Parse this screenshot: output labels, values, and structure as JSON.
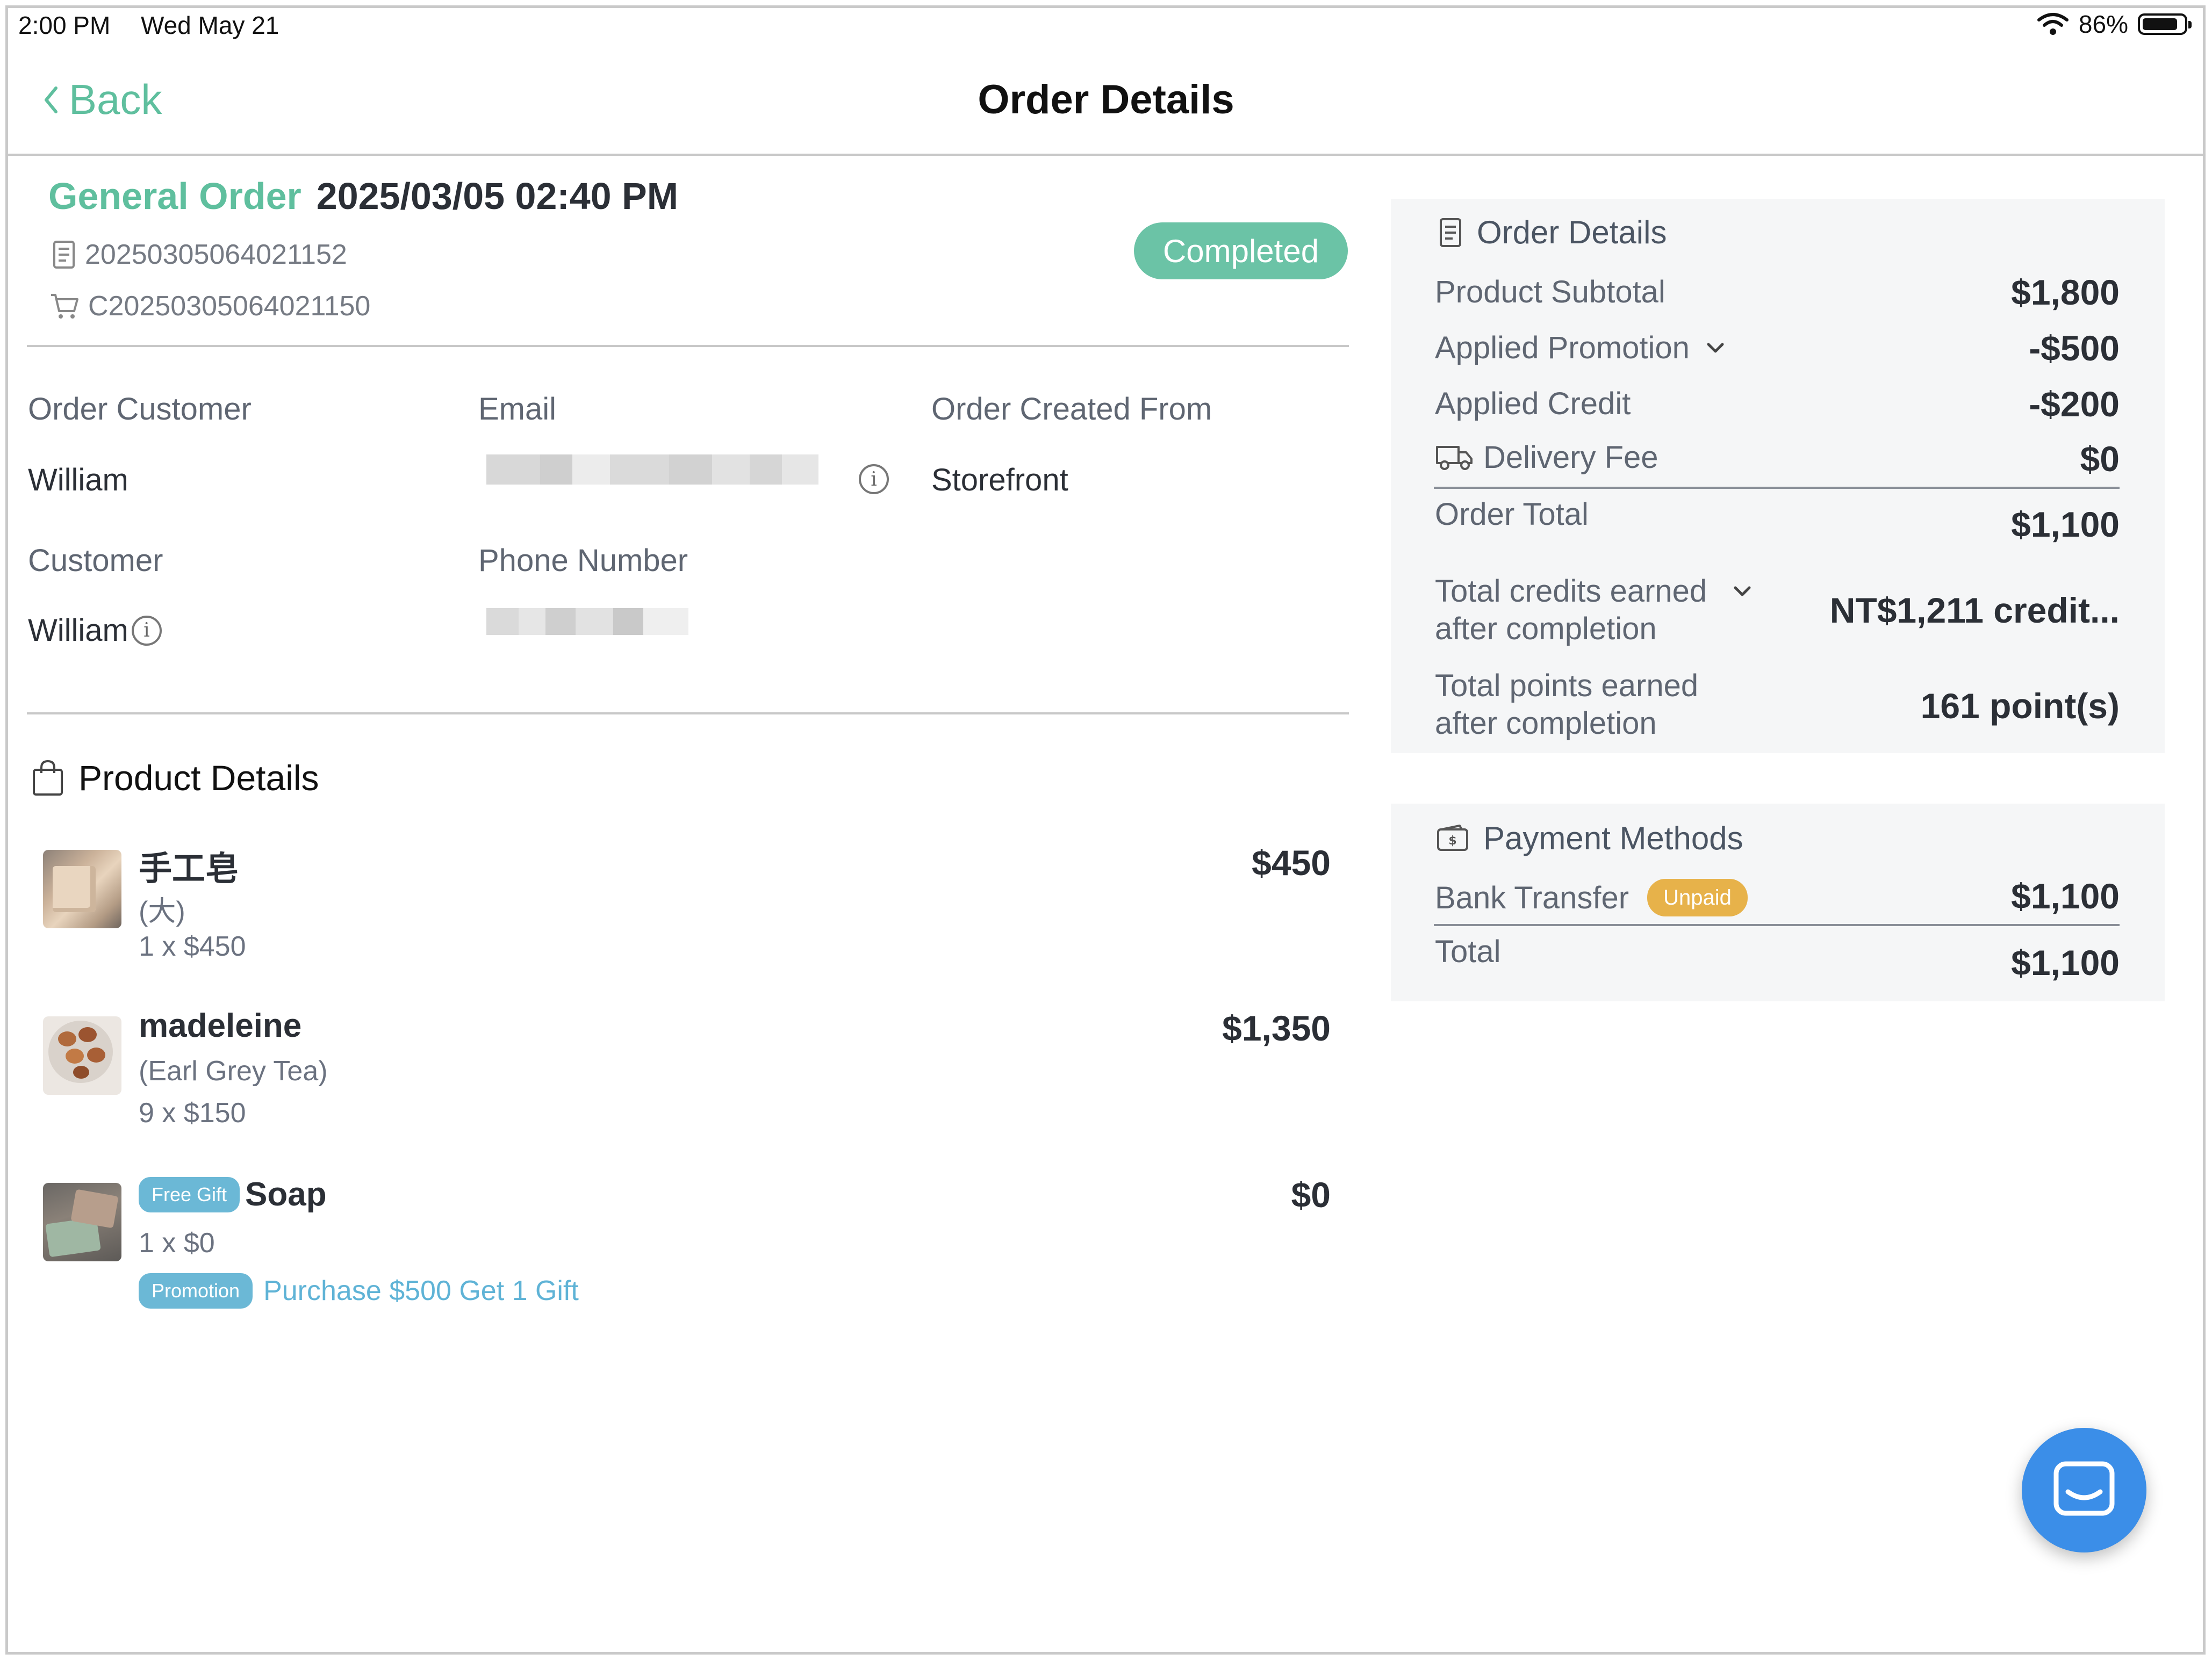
{
  "status_bar": {
    "time": "2:00 PM",
    "date": "Wed May 21",
    "battery": "86%",
    "battery_level": 0.86
  },
  "nav": {
    "back_label": "Back",
    "title": "Order Details"
  },
  "order": {
    "type": "General Order",
    "datetime": "2025/03/05 02:40 PM",
    "order_number": "20250305064021152",
    "cart_number": "C20250305064021150",
    "status": "Completed"
  },
  "customer_info": {
    "order_customer_label": "Order Customer",
    "order_customer_value": "William",
    "email_label": "Email",
    "created_from_label": "Order Created From",
    "created_from_value": "Storefront",
    "customer_label": "Customer",
    "customer_value": "William",
    "phone_label": "Phone Number"
  },
  "products": {
    "title": "Product Details",
    "items": [
      {
        "name": "手工皂",
        "variant": "(大)",
        "qty": "1 x $450",
        "price": "$450"
      },
      {
        "name": "madeleine",
        "variant": "(Earl Grey Tea)",
        "qty": "9 x $150",
        "price": "$1,350"
      },
      {
        "tag": "Free Gift",
        "name": "Soap",
        "qty": "1 x $0",
        "price": "$0",
        "promo_tag": "Promotion",
        "promo_text": "Purchase $500 Get 1 Gift"
      }
    ]
  },
  "summary": {
    "title": "Order Details",
    "subtotal_label": "Product Subtotal",
    "subtotal": "$1,800",
    "promotion_label": "Applied Promotion",
    "promotion": "-$500",
    "credit_label": "Applied Credit",
    "credit": "-$200",
    "delivery_label": "Delivery Fee",
    "delivery": "$0",
    "total_label": "Order Total",
    "total": "$1,100",
    "credits_earned_label_1": "Total credits earned",
    "credits_earned_label_2": "after completion",
    "credits_earned": "NT$1,211 credit...",
    "points_earned_label_1": "Total points earned",
    "points_earned_label_2": "after completion",
    "points_earned": "161 point(s)"
  },
  "payment": {
    "title": "Payment Methods",
    "method": "Bank Transfer",
    "method_status": "Unpaid",
    "method_amount": "$1,100",
    "total_label": "Total",
    "total": "$1,100"
  },
  "colors": {
    "accent": "#5fbf9e",
    "completed": "#6bc3a6",
    "tag_blue": "#6bb8d6",
    "unpaid": "#e7b24a",
    "chat": "#3b8ee8"
  }
}
